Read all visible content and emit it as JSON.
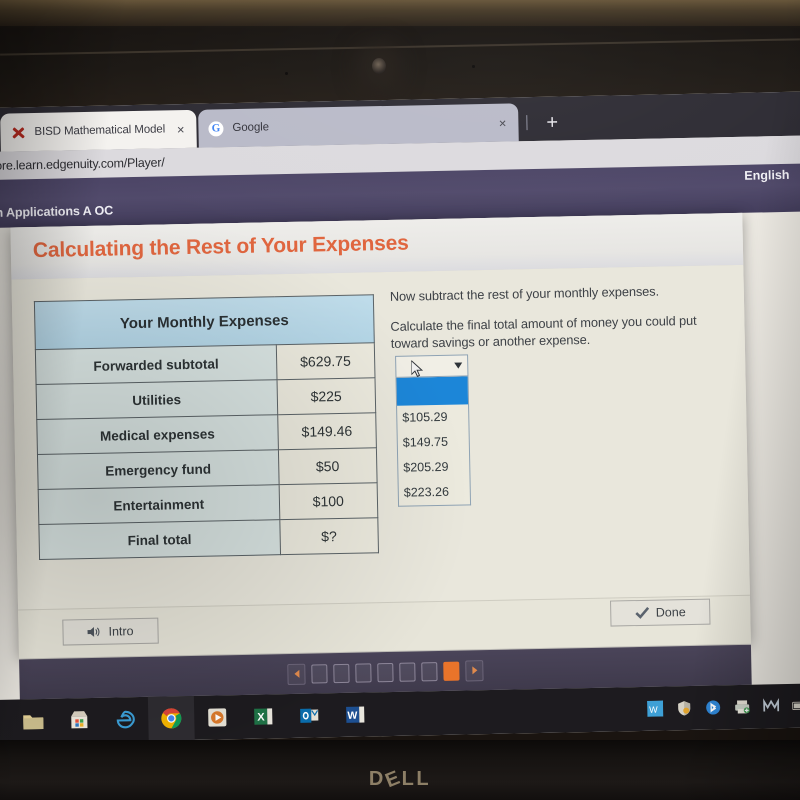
{
  "browser": {
    "tabs": [
      {
        "title": "BISD Mathematical Models with /",
        "favicon": "red-x-icon",
        "close": "×",
        "active": true
      },
      {
        "title": "Google",
        "favicon": "google-g-icon",
        "close": "×",
        "active": false
      }
    ],
    "new_tab_label": "+",
    "url": "core.learn.edgenuity.com/Player/"
  },
  "app_header": {
    "course": "ith Applications A OC",
    "language": "English"
  },
  "lesson": {
    "title": "Calculating the Rest of Your Expenses",
    "table": {
      "heading": "Your Monthly Expenses",
      "rows": [
        {
          "label": "Forwarded subtotal",
          "value": "$629.75"
        },
        {
          "label": "Utilities",
          "value": "$225"
        },
        {
          "label": "Medical expenses",
          "value": "$149.46"
        },
        {
          "label": "Emergency fund",
          "value": "$50"
        },
        {
          "label": "Entertainment",
          "value": "$100"
        },
        {
          "label": "Final total",
          "value": "$?"
        }
      ]
    },
    "instructions": [
      "Now subtract the rest of your monthly expenses.",
      "Calculate the final total amount of money you could put toward savings or another expense."
    ],
    "dropdown": {
      "selected_value": "",
      "expanded": true,
      "caret": "▼",
      "options": [
        "",
        "$105.29",
        "$149.75",
        "$205.29",
        "$223.26"
      ]
    },
    "footer": {
      "intro_label": "Intro",
      "intro_icon": "speaker-icon",
      "done_label": "Done",
      "done_icon": "checkmark-icon"
    }
  },
  "pager": {
    "prev_icon": "triangle-left-icon",
    "next_icon": "triangle-right-icon",
    "total_steps": 7,
    "current_step": 7,
    "active_color": "#e9742a"
  },
  "taskbar": {
    "items": [
      {
        "name": "file-explorer-icon",
        "active": false
      },
      {
        "name": "microsoft-store-icon",
        "active": false
      },
      {
        "name": "internet-explorer-icon",
        "active": false
      },
      {
        "name": "google-chrome-icon",
        "active": true
      },
      {
        "name": "media-player-icon",
        "active": false
      },
      {
        "name": "excel-icon",
        "active": false
      },
      {
        "name": "outlook-icon",
        "active": false
      },
      {
        "name": "word-icon",
        "active": false
      }
    ],
    "tray": [
      {
        "name": "app-tray-icon"
      },
      {
        "name": "security-shield-icon"
      },
      {
        "name": "bluetooth-icon"
      },
      {
        "name": "printer-icon"
      },
      {
        "name": "mail-icon"
      },
      {
        "name": "battery-icon"
      }
    ]
  },
  "hardware": {
    "brand": "DELL",
    "brand_pre": "D",
    "brand_e": "E",
    "brand_post": "LL"
  },
  "colors": {
    "title_orange": "#e0663f",
    "header_purple": "#4c4566",
    "table_header_blue": "#b4d6e7",
    "dropdown_highlight": "#1c86d8"
  }
}
